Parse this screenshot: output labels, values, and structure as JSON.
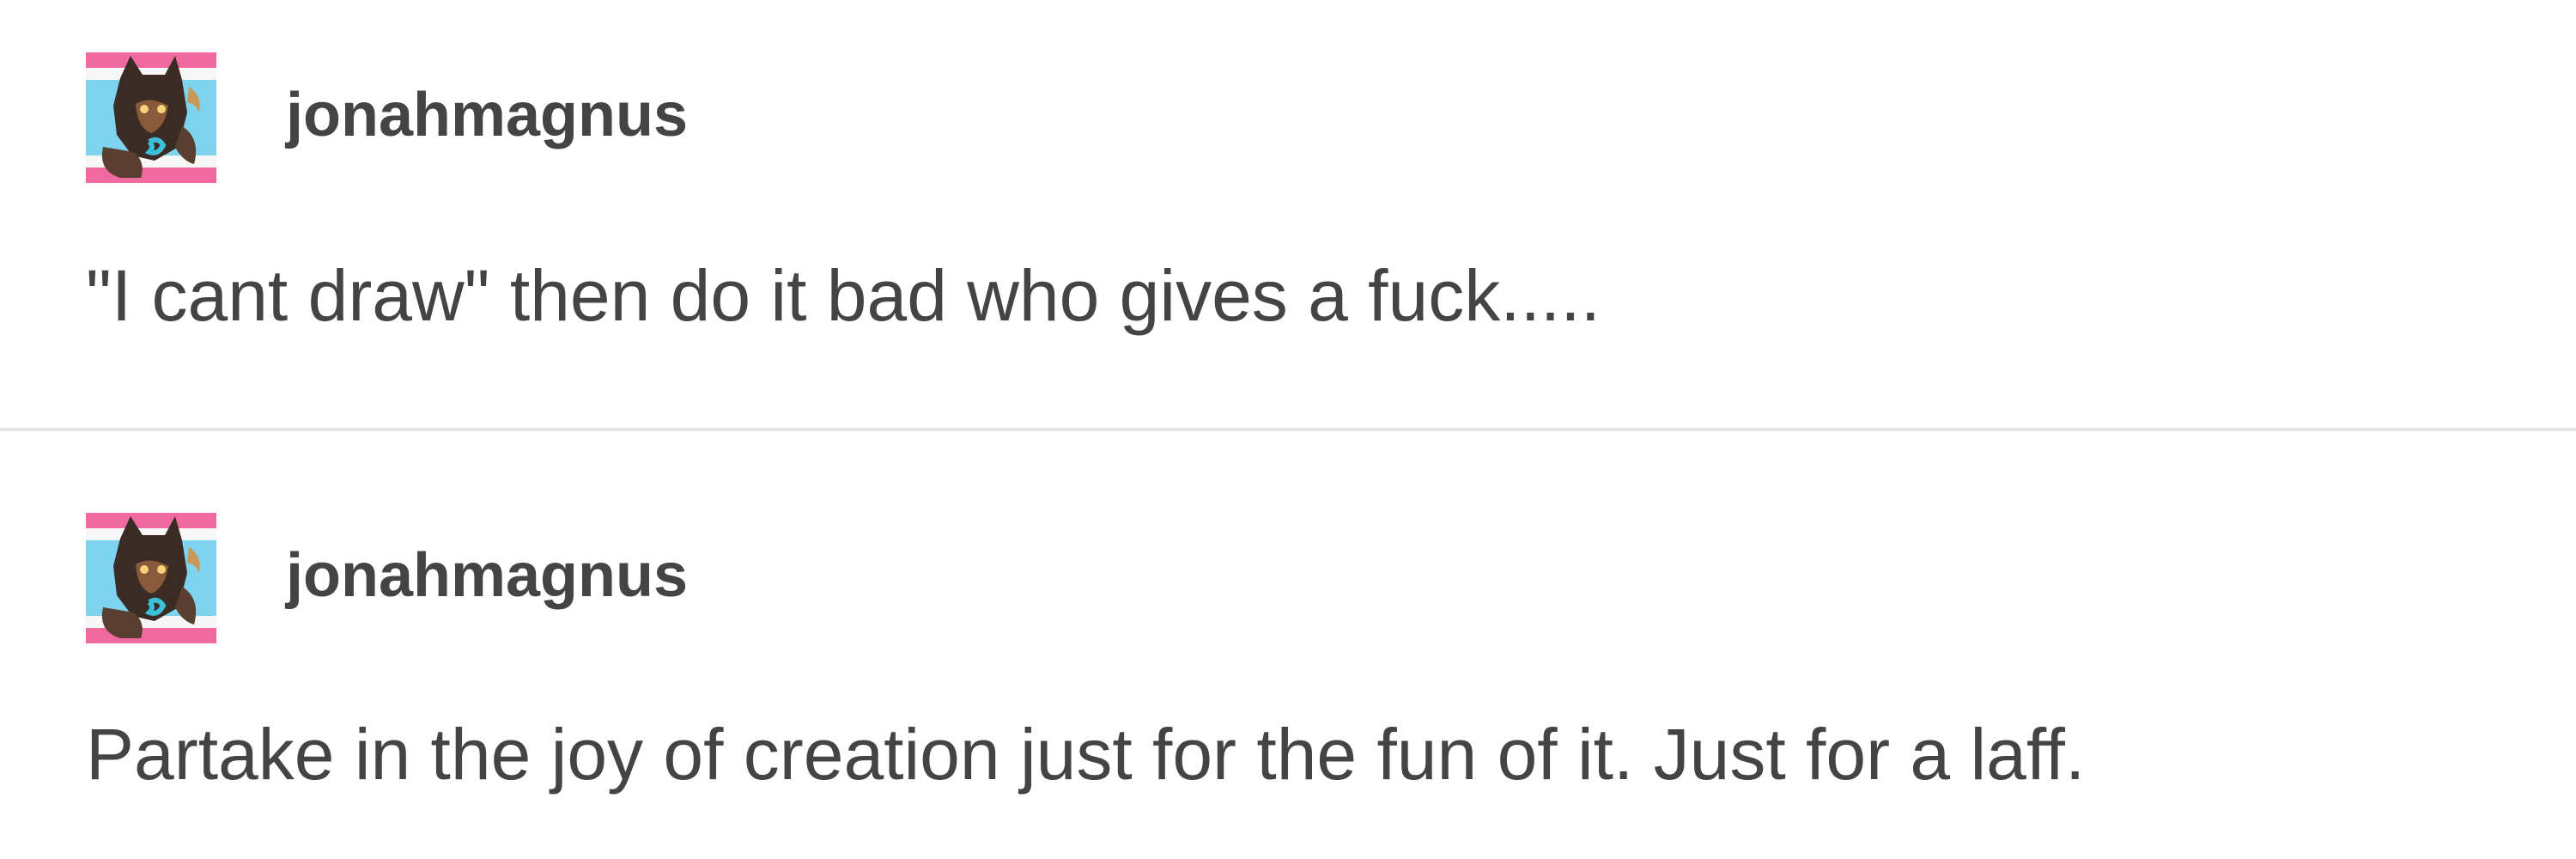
{
  "posts": [
    {
      "username": "jonahmagnus",
      "avatar_icon": "character-avatar-icon",
      "text": "\"I cant draw\" then do it bad who gives a fuck....."
    },
    {
      "username": "jonahmagnus",
      "avatar_icon": "character-avatar-icon",
      "text": "Partake in the joy of creation just for the fun of it. Just for a laff."
    }
  ],
  "colors": {
    "text": "#444444",
    "divider": "#e4e4e4",
    "avatar_pink": "#f06aa0",
    "avatar_blue": "#7ed3ee"
  }
}
